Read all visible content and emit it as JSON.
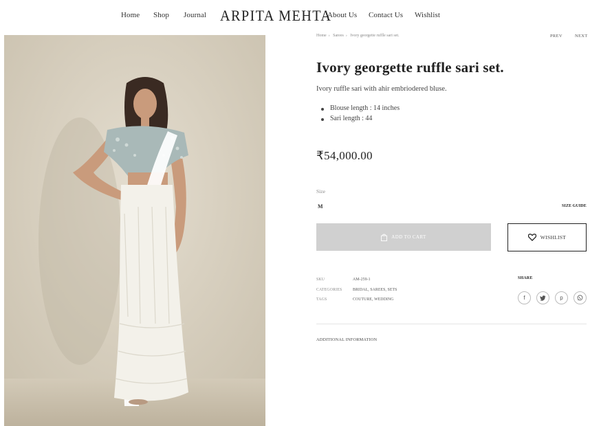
{
  "nav": {
    "left": [
      "Home",
      "Shop",
      "Journal"
    ],
    "brand": "ARPITA MEHTA",
    "right": [
      "About Us",
      "Contact Us",
      "Wishlist"
    ]
  },
  "breadcrumb": [
    "Home",
    "Sarees",
    "Ivory georgette ruffle sari set."
  ],
  "pager": {
    "prev": "PREV",
    "next": "NEXT"
  },
  "product": {
    "title": "Ivory georgette ruffle sari set.",
    "description": "Ivory ruffle sari with ahir embriodered bluse.",
    "bullets": [
      "Blouse length : 14 inches",
      "Sari length : 44"
    ],
    "price": "₹54,000.00",
    "size_label": "Size",
    "size_value": "M",
    "size_guide": "SIZE GUIDE",
    "add_to_cart": "ADD TO CART",
    "wishlist": "WISHLIST"
  },
  "meta": {
    "sku_label": "SKU",
    "sku_value": "AM-259-1",
    "categories_label": "CATEGORIES",
    "categories_value": "BRIDAL, SAREES, SETS",
    "tags_label": "TAGS",
    "tags_value": "COUTURE, WEDDING"
  },
  "share": {
    "label": "SHARE",
    "icons": [
      "facebook-icon",
      "twitter-icon",
      "pinterest-icon",
      "whatsapp-icon"
    ]
  },
  "additional_information": "ADDITIONAL INFORMATION",
  "colors": {
    "button_disabled": "#d0d0d0",
    "text": "#222222",
    "backdrop": "#d9d2c3",
    "sari": "#f3f1ea"
  }
}
